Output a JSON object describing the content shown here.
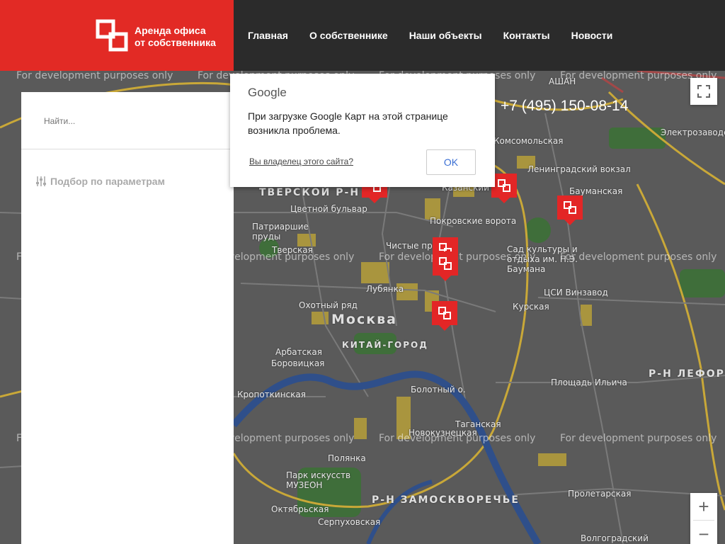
{
  "brand": {
    "line1": "Аренда офиса",
    "line2": "от собственника"
  },
  "nav": {
    "items": [
      "Главная",
      "О собственнике",
      "Наши объекты",
      "Контакты",
      "Новости"
    ]
  },
  "search": {
    "placeholder": "Найти..."
  },
  "filter": {
    "label": "Подбор по параметрам"
  },
  "phone": "+7 (495) 150-08-14",
  "google_dialog": {
    "logo": "Google",
    "message": "При загрузке Google Карт на этой странице возникла проблема.",
    "owner_link": "Вы владелец этого сайта?",
    "ok_label": "OK"
  },
  "map": {
    "watermark": "For development purposes only",
    "labels": {
      "moskva": "Москва",
      "kitay_gorod": "КИТАЙ-ГОРОД",
      "tverskoy": "ТВЕРСКОЙ Р-Н",
      "zamoskvorechye": "Р-Н ЗАМОСКВОРЕЧЬЕ",
      "lefortovo": "Р-Н ЛЕФОРТ",
      "leningradsky": "Ленинградский вокзал",
      "kazansky": "Казанский",
      "komsomolskaya": "Комсомольская",
      "baumanskaya": "Бауманская",
      "tsvetnoy": "Цветной бульвар",
      "patriarshie": "Патриаршие пруды",
      "tverskaya": "Тверская",
      "chistye": "Чистые пр",
      "pokrovskie": "Покровские ворота",
      "sad_kultury": "Сад культуры и отдыха им. Н.Э. Баумана",
      "lubyanka": "Лубянка",
      "okhotny": "Охотный ряд",
      "kitay_gorod_st": "Китай-город",
      "kurskaya": "Курская",
      "tsi_vinzavod": "ЦСИ Винзавод",
      "arbatskaya": "Арбатская",
      "borovitskaya": "Боровицкая",
      "kropotkinskaya": "Кропоткинская",
      "bolotny": "Болотный о.",
      "taganskaya": "Таганская",
      "novokuznetskaya": "Новокузнецкая",
      "polyanka": "Полянка",
      "park_muzeon": "Парк искусств МУЗЕОН",
      "oktyabrskaya": "Октябрьская",
      "serpukhovskaya": "Серпуховская",
      "proletarskaya": "Пролетарская",
      "ploshchad_ilyicha": "Площадь Ильича",
      "elektrozavodskaya": "Электрозаводская",
      "volgogradsky": "Волгоградский",
      "ashan": "АШАН"
    }
  },
  "controls": {
    "zoom_in": "+",
    "zoom_out": "−"
  },
  "colors": {
    "brand_red": "#e22a25",
    "header_dark": "#2b2b2b",
    "link_blue": "#3b6fd4"
  }
}
